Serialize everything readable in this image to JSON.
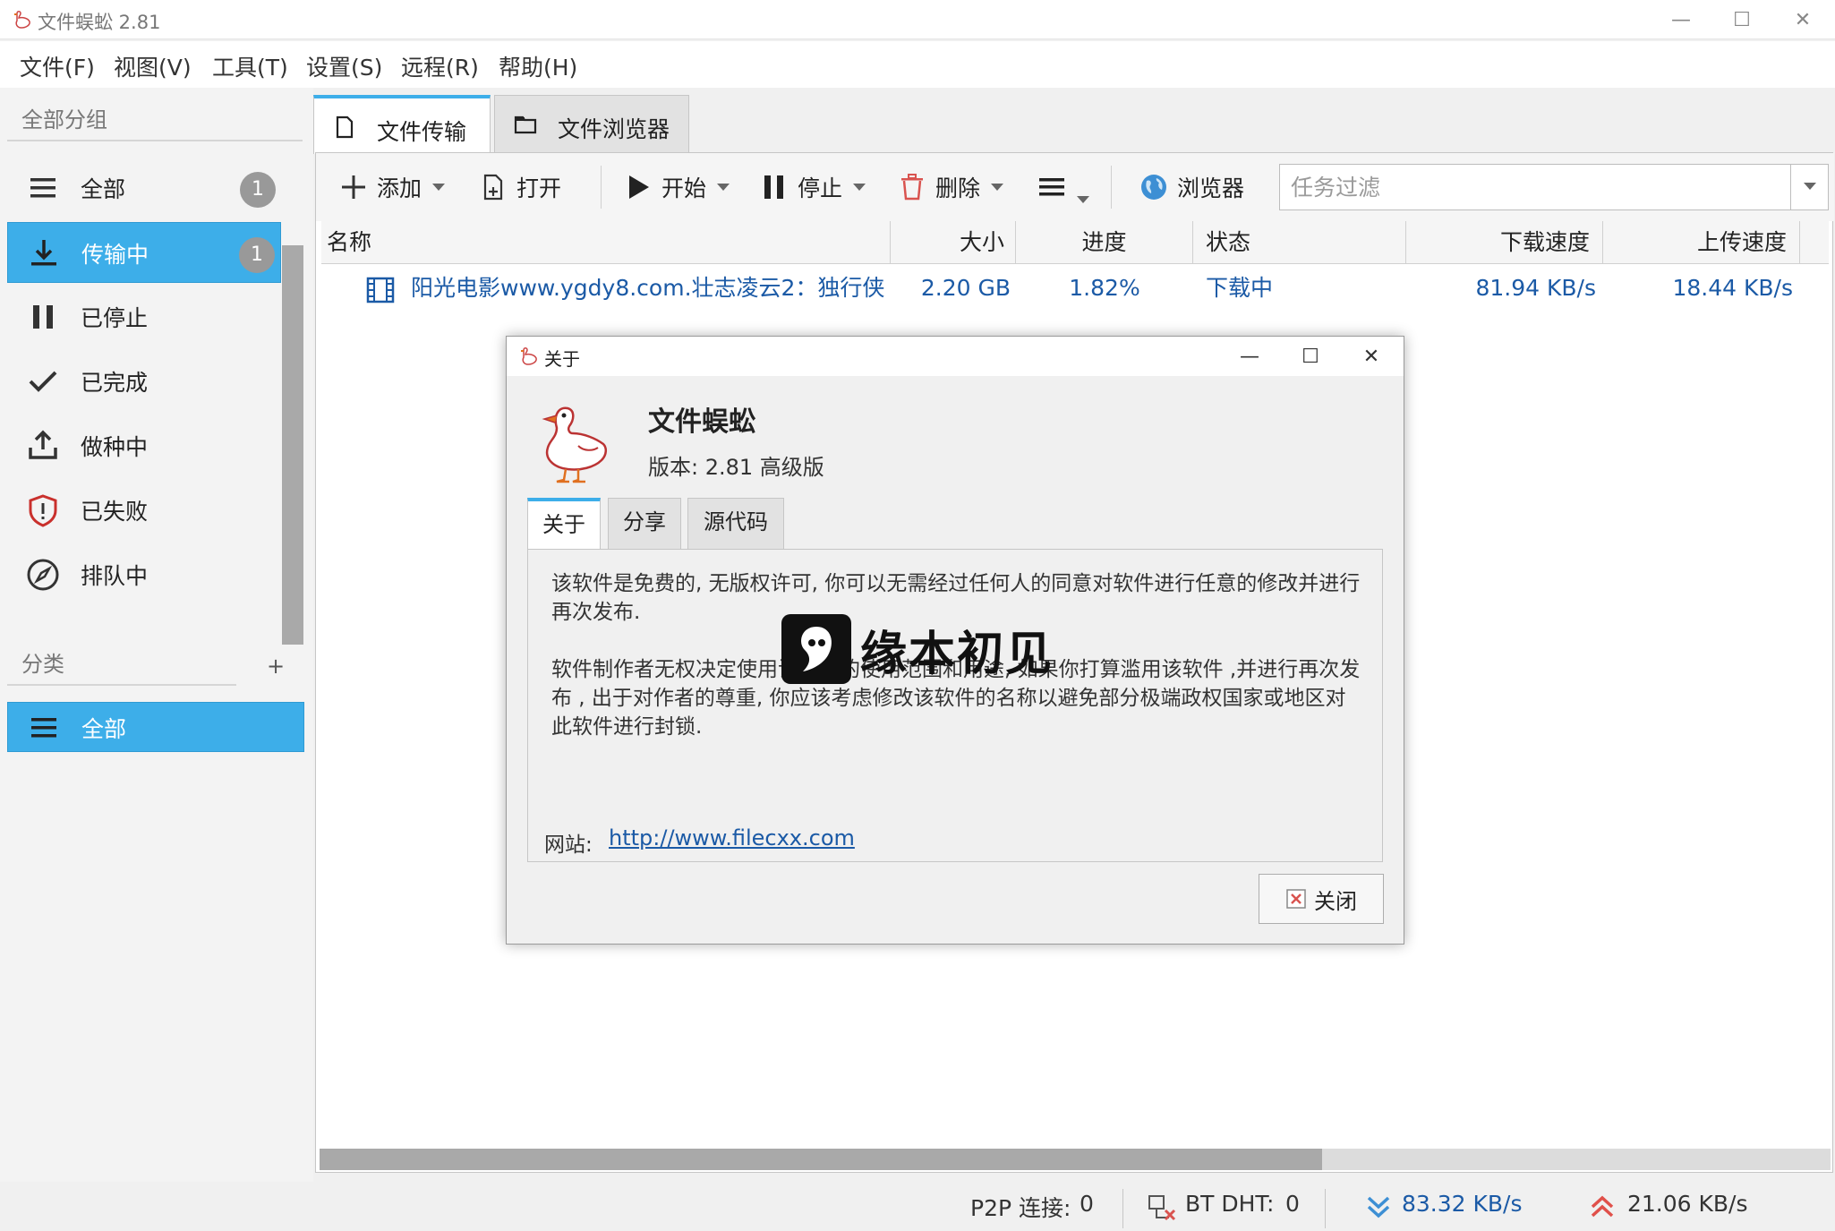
{
  "window": {
    "title": "文件蜈蚣 2.81",
    "controls": {
      "minimize": "—",
      "maximize": "☐",
      "close": "✕"
    }
  },
  "menu": [
    "文件(F)",
    "视图(V)",
    "工具(T)",
    "设置(S)",
    "远程(R)",
    "帮助(H)"
  ],
  "sidebar": {
    "group_header": "全部分组",
    "items": [
      {
        "label": "全部",
        "icon": "hamburger-icon",
        "badge": "1",
        "active": false
      },
      {
        "label": "传输中",
        "icon": "download-icon",
        "badge": "1",
        "active": true
      },
      {
        "label": "已停止",
        "icon": "pause-icon",
        "active": false
      },
      {
        "label": "已完成",
        "icon": "check-icon",
        "active": false
      },
      {
        "label": "做种中",
        "icon": "upload-icon",
        "active": false
      },
      {
        "label": "已失败",
        "icon": "shield-alert-icon",
        "active": false
      },
      {
        "label": "排队中",
        "icon": "compass-icon",
        "active": false
      }
    ],
    "category_header": "分类",
    "add_category": "+",
    "category_items": [
      {
        "label": "全部",
        "icon": "hamburger-icon",
        "active": true
      }
    ]
  },
  "tabs": [
    {
      "label": "文件传输",
      "icon": "file-icon",
      "active": true
    },
    {
      "label": "文件浏览器",
      "icon": "folder-icon",
      "active": false
    }
  ],
  "toolbar": {
    "add": "添加",
    "open": "打开",
    "start": "开始",
    "stop": "停止",
    "delete": "删除",
    "browser": "浏览器",
    "filter_placeholder": "任务过滤"
  },
  "table": {
    "columns": [
      "名称",
      "大小",
      "进度",
      "状态",
      "下载速度",
      "上传速度"
    ],
    "rows": [
      {
        "name": "阳光电影www.ygdy8.com.壮志凌云2：独行侠....",
        "size": "2.20 GB",
        "progress": "1.82%",
        "status": "下载中",
        "down": "81.94 KB/s",
        "up": "18.44 KB/s"
      }
    ]
  },
  "statusbar": {
    "p2p_label": "P2P 连接:",
    "p2p_value": "0",
    "dht_label": "BT DHT:",
    "dht_value": "0",
    "down_speed": "83.32 KB/s",
    "up_speed": "21.06 KB/s"
  },
  "dialog": {
    "title": "关于",
    "app_name": "文件蜈蚣",
    "version": "版本: 2.81 高级版",
    "tabs": [
      "关于",
      "分享",
      "源代码"
    ],
    "para1": "该软件是免费的, 无版权许可, 你可以无需经过任何人的同意对软件进行任意的修改并进行再次发布.",
    "para2": "软件制作者无权决定使用该软件的使用范围和用途, 如果你打算滥用该软件 ,并进行再次发布 , 出于对作者的尊重, 你应该考虑修改该软件的名称以避免部分极端政权国家或地区对此软件进行封锁.",
    "site_label": "网站:",
    "site_url": "http://www.filecxx.com",
    "close": "关闭"
  },
  "watermark": {
    "text": "缘本初见"
  },
  "colors": {
    "accent": "#3daee9",
    "link": "#1b5aa6",
    "delete_red": "#d9534f",
    "down_blue": "#3d8fd4",
    "up_red": "#e0504a"
  }
}
